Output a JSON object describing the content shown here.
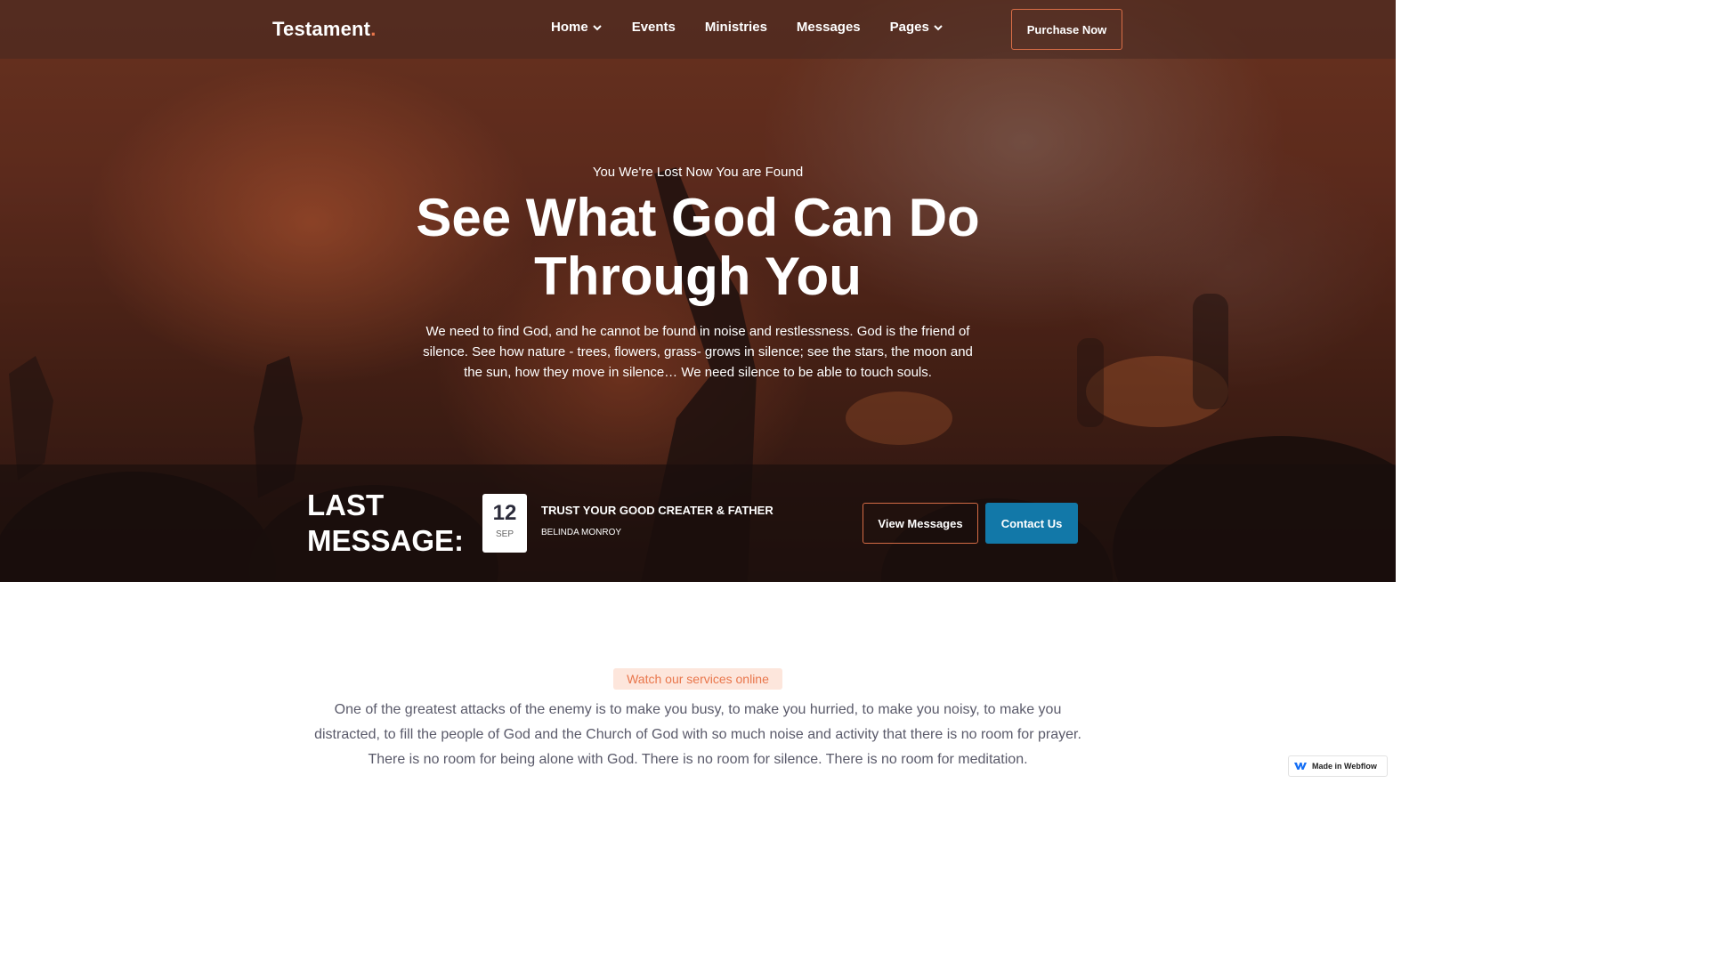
{
  "brand": {
    "name": "Testament",
    "dot": ".",
    "accent_color": "#e9764b"
  },
  "nav": {
    "items": [
      {
        "label": "Home",
        "has_dropdown": true
      },
      {
        "label": "Events",
        "has_dropdown": false
      },
      {
        "label": "Ministries",
        "has_dropdown": false
      },
      {
        "label": "Messages",
        "has_dropdown": false
      },
      {
        "label": "Pages",
        "has_dropdown": true
      }
    ],
    "cta_label": "Purchase Now"
  },
  "hero": {
    "kicker": "You We're Lost Now You are Found",
    "title": "See What God Can Do Through You",
    "text": "We need to find God, and he cannot be found in noise and restlessness. God is the friend of silence. See how nature - trees, flowers, grass- grows in silence; see the stars, the moon and the sun, how they move in silence… We need silence to be able to touch souls."
  },
  "last_message": {
    "heading": "LAST MESSAGE:",
    "day": "12",
    "month": "SEP",
    "title": "TRUST YOUR GOOD CREATER & FATHER",
    "author": "BELINDA MONROY",
    "view_label": "View Messages",
    "contact_label": "Contact Us",
    "contact_color": "#1278a8"
  },
  "services": {
    "badge": "Watch our services online",
    "text": "One of the greatest attacks of the enemy is to make you busy, to make you hurried, to make you noisy, to make you distracted, to fill the people of God and the Church of God with so much noise and activity that there is no room for prayer. There is no room for being alone with God. There is no room for silence. There is no room for meditation."
  },
  "webflow_badge": {
    "label": "Made in Webflow"
  }
}
